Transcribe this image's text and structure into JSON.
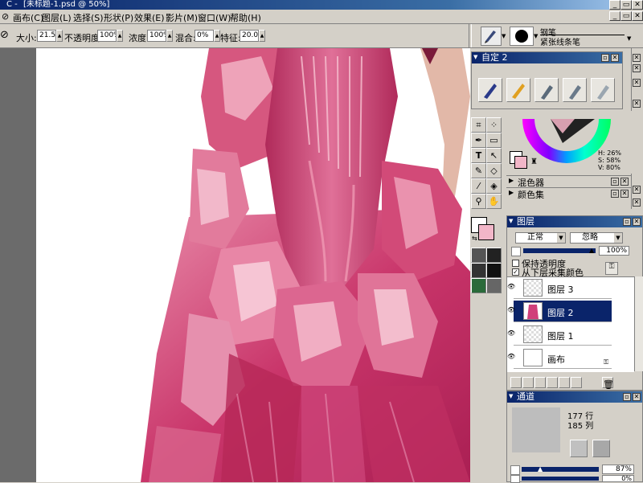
{
  "window": {
    "title": "[未标题-1.psd @ 50%]",
    "title_prefix": "C -",
    "controls": [
      "_",
      "▭",
      "✕"
    ]
  },
  "menu": {
    "items": [
      {
        "label": "画布(C)"
      },
      {
        "label": "图层(L)"
      },
      {
        "label": "选择(S)"
      },
      {
        "label": "形状(P)"
      },
      {
        "label": "效果(E)"
      },
      {
        "label": "影片(M)"
      },
      {
        "label": "窗口(W)"
      },
      {
        "label": "帮助(H)"
      }
    ]
  },
  "property_bar": {
    "size_label": "大小:",
    "size_value": "21.5",
    "opacity_label": "不透明度:",
    "opacity_value": "100%",
    "density_label": "浓度:",
    "density_value": "100%",
    "blend_label": "混合:",
    "blend_value": "0%",
    "feature_label": "特征:",
    "feature_value": "20.0",
    "brush_category": "钢笔",
    "brush_variant": "紧张线条笔"
  },
  "custom_palette": {
    "title": "自定",
    "number": "2"
  },
  "color_panel": {
    "h": "H: 26%",
    "s": "S: 58%",
    "v": "V: 80%",
    "mixer_label": "混色器",
    "color_set_label": "颜色集",
    "primary_color": "#f2b6c8",
    "secondary_color": "#ffffff"
  },
  "layers_panel": {
    "title": "图层",
    "composite_method": "正常",
    "composite_depth": "忽略",
    "opacity": "100%",
    "preserve_transparency": "保持透明度",
    "pick_up_color": "从下层采集颜色",
    "layers": [
      {
        "name": "图层 3",
        "selected": false
      },
      {
        "name": "图层 2",
        "selected": true
      },
      {
        "name": "图层 1",
        "selected": false
      },
      {
        "name": "画布",
        "selected": false
      }
    ]
  },
  "channels_panel": {
    "title": "通道",
    "rows": "177 行",
    "cols": "185 列",
    "zoom_value": "87%",
    "second_value": "0%"
  }
}
